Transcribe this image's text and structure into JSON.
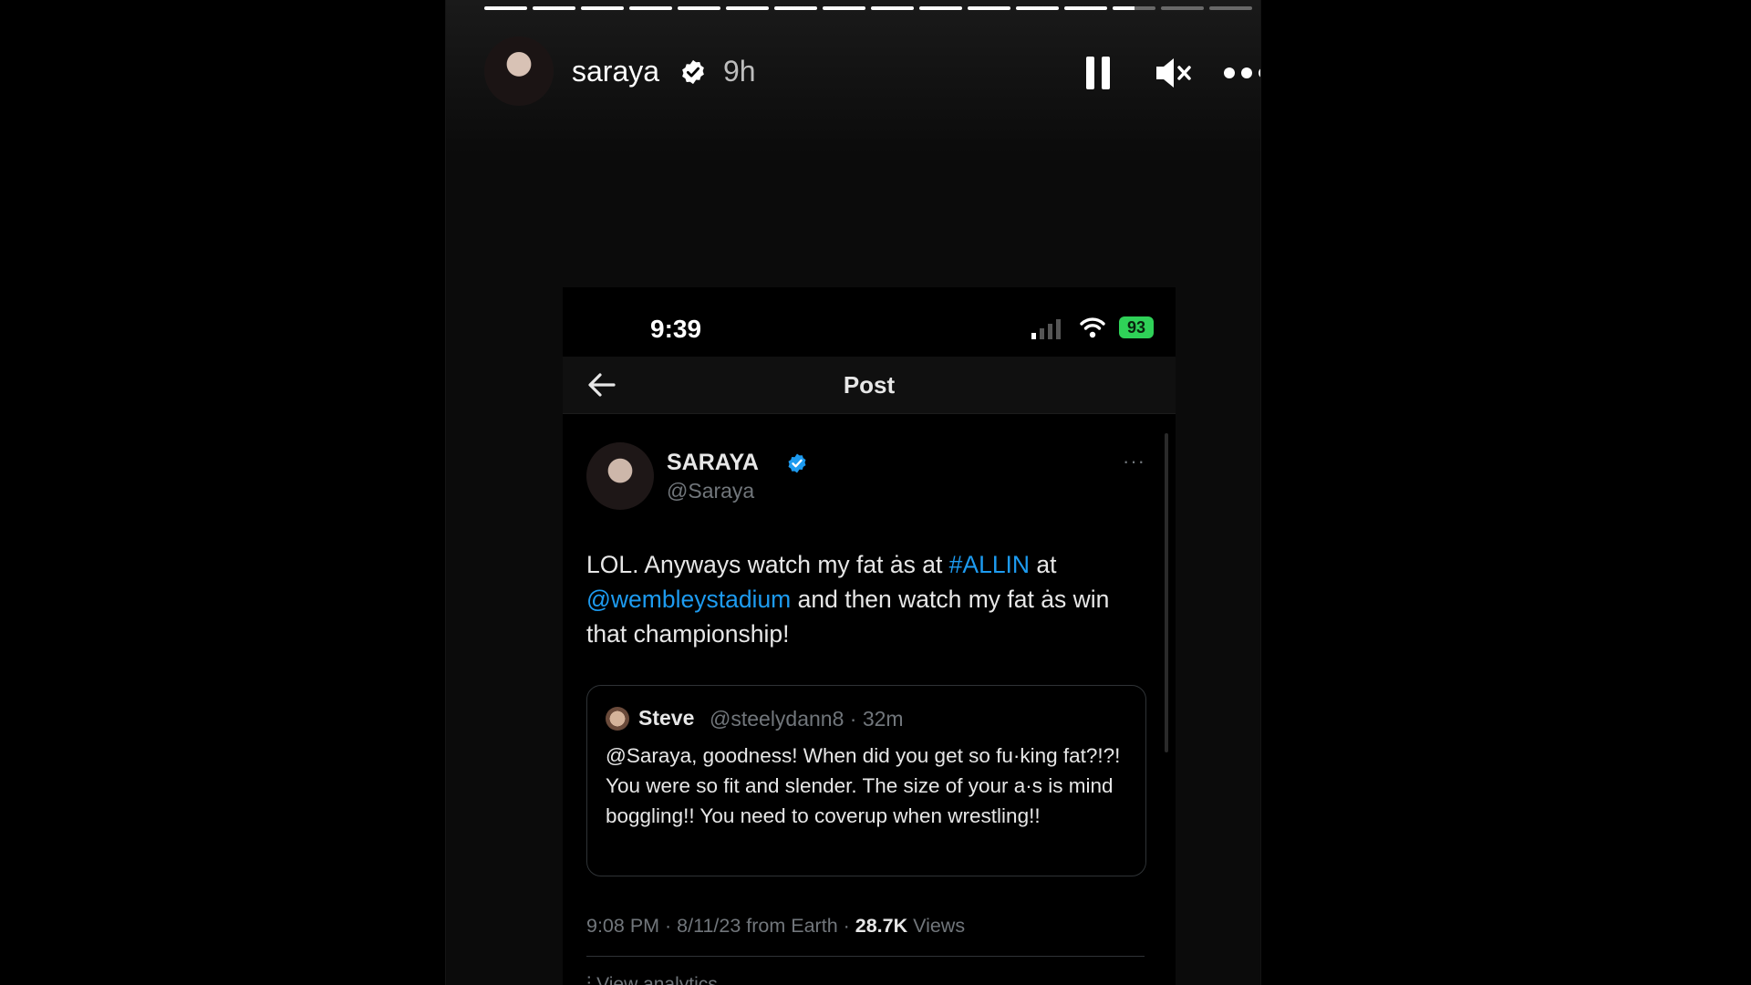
{
  "story": {
    "username": "saraya",
    "time": "9h",
    "progress": {
      "segments_total": 16,
      "segments_complete": 13,
      "current_segment_fraction": 0.5
    }
  },
  "phone": {
    "status_time": "9:39",
    "battery": "93",
    "battery_color": "#2fd158",
    "nav_title": "Post"
  },
  "post": {
    "author_name": "SARAYA",
    "author_handle": "@Saraya",
    "more": "···",
    "text_1": "LOL. Anyways watch my fat ȧs at ",
    "hashtag": "#ALLIN",
    "text_2": " at",
    "mention": "@wembleystadium",
    "text_3": " and then watch my fat ȧs win that championship!",
    "link_color": "#1d9bf0",
    "quote": {
      "name": "Steve",
      "meta": "@steelydann8 · 32m",
      "text": "@Saraya, goodness! When did you get so fu·king fat?!?! You were so fit and slender. The size of your a·s is mind boggling!! You need to coverup when wrestling!!"
    },
    "footer_time": "9:08 PM · 8/11/23 from Earth · ",
    "views_count": "28.7K",
    "views_label": " Views",
    "analytics_label": "View analytics"
  },
  "icons": [
    "verified-icon",
    "pause-icon",
    "mute-icon",
    "more-icon",
    "signal-icon",
    "wifi-icon",
    "battery-icon",
    "back-arrow-icon"
  ]
}
